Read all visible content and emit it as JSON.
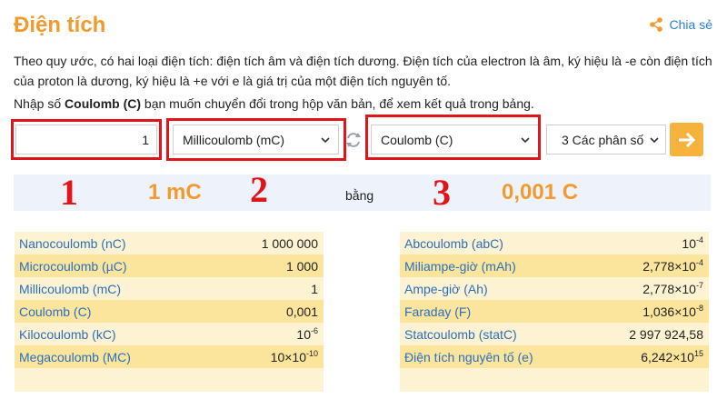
{
  "header": {
    "title": "Điện tích",
    "share_label": "Chia sẻ",
    "share_icon": "share-icon"
  },
  "intro": "Theo quy ước, có hai loại điện tích: điện tích âm và điện tích dương. Điện tích của electron là âm, ký hiệu là -e còn điện tích của proton là dương, ký hiệu là +e với e là giá trị của một điện tích nguyên tố.",
  "prompt": {
    "before": "Nhập số ",
    "bold": "Coulomb (C)",
    "after": " bạn muốn chuyển đổi trong hộp văn bản, để xem kết quả trong bảng."
  },
  "converter": {
    "input_value": "1",
    "from_unit": "Millicoulomb (mC)",
    "to_unit": "Coulomb (C)",
    "decimals": "3 Các phân số",
    "swap_icon": "swap-arrows-icon",
    "go_icon": "arrow-right-icon",
    "accent_color": "#f5b23c"
  },
  "annotations": {
    "box1": "1",
    "box2": "2",
    "box3": "3",
    "color": "#e0141b"
  },
  "result": {
    "from": "1 mC",
    "equals": "bằng",
    "to": "0,001 C"
  },
  "table_left": [
    {
      "name": "Nanocoulomb (nC)",
      "value": "1 000 000"
    },
    {
      "name": "Microcoulomb (µC)",
      "value": "1 000"
    },
    {
      "name": "Millicoulomb (mC)",
      "value": "1"
    },
    {
      "name": "Coulomb (C)",
      "value": "0,001"
    },
    {
      "name": "Kilocoulomb (kC)",
      "value": "10",
      "exp": "-6"
    },
    {
      "name": "Megacoulomb (MC)",
      "value": "10×10",
      "exp": "-10"
    }
  ],
  "table_right": [
    {
      "name": "Abcoulomb (abC)",
      "value": "10",
      "exp": "-4"
    },
    {
      "name": "Miliampe-giờ (mAh)",
      "value": "2,778×10",
      "exp": "-4"
    },
    {
      "name": "Ampe-giờ (Ah)",
      "value": "2,778×10",
      "exp": "-7"
    },
    {
      "name": "Faraday (F)",
      "value": "1,036×10",
      "exp": "-8"
    },
    {
      "name": "Statcoulomb (statC)",
      "value": "2 997 924,58"
    },
    {
      "name": "Điện tích nguyên tố (e)",
      "value": "6,242×10",
      "exp": "15"
    }
  ]
}
